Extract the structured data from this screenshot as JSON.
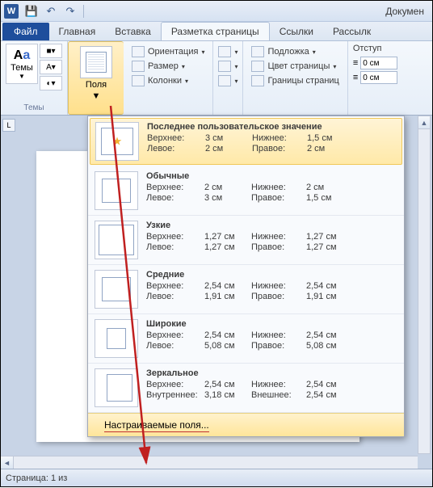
{
  "title": "Докумен",
  "qat": {
    "save": "💾",
    "undo": "↶",
    "redo": "↷"
  },
  "tabs": {
    "file": "Файл",
    "items": [
      "Главная",
      "Вставка",
      "Разметка страницы",
      "Ссылки",
      "Рассылк"
    ],
    "active_index": 2
  },
  "ribbon": {
    "themes": {
      "label": "Темы",
      "big": "Темы",
      "aa": "Aa"
    },
    "margins": {
      "label": "Поля"
    },
    "page_setup": {
      "orientation": "Ориентация",
      "size": "Размер",
      "columns": "Колонки"
    },
    "page_bg": {
      "watermark": "Подложка",
      "page_color": "Цвет страницы",
      "borders": "Границы страниц"
    },
    "indent": {
      "label": "Отступ",
      "left": "0 см",
      "right": "0 см"
    }
  },
  "dropdown": {
    "labels": {
      "top": "Верхнее:",
      "bottom": "Нижнее:",
      "left": "Левое:",
      "right": "Правое:",
      "inner": "Внутреннее:",
      "outer": "Внешнее:"
    },
    "items": [
      {
        "title": "Последнее пользовательское значение",
        "top": "3 см",
        "bottom": "1,5 см",
        "left": "2 см",
        "right": "2 см",
        "icon": "last",
        "hl": true
      },
      {
        "title": "Обычные",
        "top": "2 см",
        "bottom": "2 см",
        "left": "3 см",
        "right": "1,5 см",
        "icon": "normal"
      },
      {
        "title": "Узкие",
        "top": "1,27 см",
        "bottom": "1,27 см",
        "left": "1,27 см",
        "right": "1,27 см",
        "icon": "narrow"
      },
      {
        "title": "Средние",
        "top": "2,54 см",
        "bottom": "2,54 см",
        "left": "1,91 см",
        "right": "1,91 см",
        "icon": "normal"
      },
      {
        "title": "Широкие",
        "top": "2,54 см",
        "bottom": "2,54 см",
        "left": "5,08 см",
        "right": "5,08 см",
        "icon": "wide"
      },
      {
        "title": "Зеркальное",
        "top": "2,54 см",
        "bottom": "2,54 см",
        "left_lbl": "inner",
        "right_lbl": "outer",
        "left": "3,18 см",
        "right": "2,54 см",
        "icon": "mirror"
      }
    ],
    "custom": "Настраиваемые поля..."
  },
  "status": "Страница: 1 из",
  "ruler_corner": "L"
}
